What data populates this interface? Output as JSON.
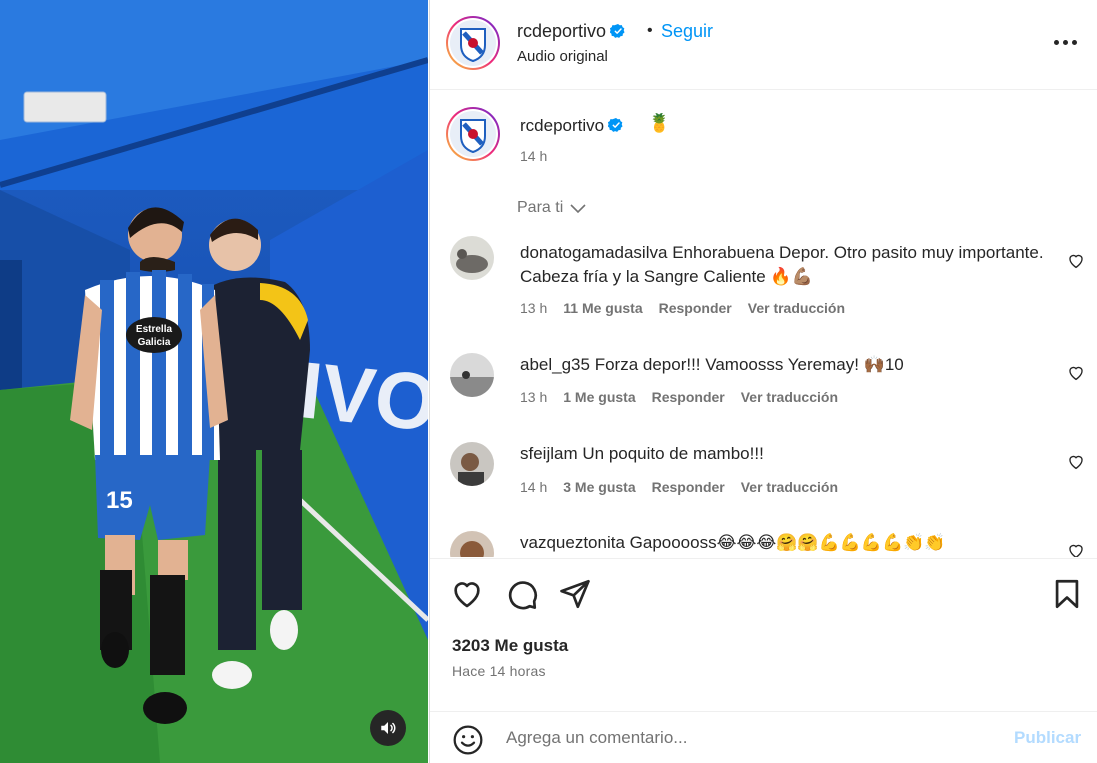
{
  "post": {
    "username": "rcdeportivo",
    "follow_label": "Seguir",
    "separator": "•",
    "audio_label": "Audio original"
  },
  "caption": {
    "username": "rcdeportivo",
    "emoji": "🍍",
    "time": "14 h"
  },
  "filter_label": "Para ti",
  "comments": [
    {
      "username": "donatogamadasilva",
      "text": "Enhorabuena Depor. Otro pasito muy importante. Cabeza fría y la Sangre Caliente 🔥💪🏽",
      "time": "13 h",
      "likes": "11 Me gusta",
      "reply": "Responder",
      "translate": "Ver traducción"
    },
    {
      "username": "abel_g35",
      "text": "Forza depor!!! Vamoosss Yeremay! 🙌🏾10",
      "time": "13 h",
      "likes": "1 Me gusta",
      "reply": "Responder",
      "translate": "Ver traducción"
    },
    {
      "username": "sfeijlam",
      "text": "Un poquito de mambo!!!",
      "time": "14 h",
      "likes": "3 Me gusta",
      "reply": "Responder",
      "translate": "Ver traducción"
    },
    {
      "username": "vazqueztonita",
      "text": "Gapooooss😂😂😂🤗🤗💪💪💪💪👏👏"
    }
  ],
  "stats": {
    "likes": "3203 Me gusta",
    "posted": "Hace 14 horas"
  },
  "add_comment": {
    "placeholder": "Agrega un comentario...",
    "publish_label": "Publicar"
  },
  "media": {
    "shirt_text_1": "Estrella",
    "shirt_text_2": "Galicia",
    "number": "15",
    "wall_text": "IVO"
  },
  "colors": {
    "accent": "#0095f6",
    "publish_disabled": "#b3dbff",
    "secondary_text": "#737373"
  }
}
